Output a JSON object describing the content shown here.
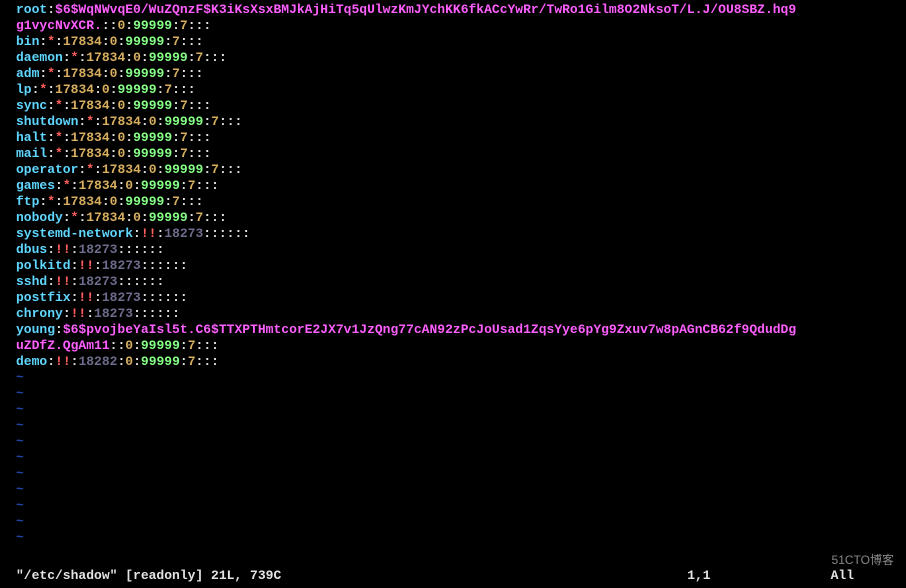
{
  "lines": [
    {
      "segments": [
        {
          "t": "root",
          "c": "c-cyan"
        },
        {
          "t": ":",
          "c": "c-white"
        },
        {
          "t": "$6$WqNWvqE0/WuZQnzF$K3iKsXsxBMJkAjHiTq5qUlwzKmJYchKK6fkACcYwRr/TwRo1Gilm8O2NksoT/L.J/OU8SBZ.hq9",
          "c": "c-pink"
        }
      ]
    },
    {
      "segments": [
        {
          "t": "g1vycNvXCR.",
          "c": "c-pink"
        },
        {
          "t": ":",
          "c": "c-white"
        },
        {
          "t": ":",
          "c": "c-white"
        },
        {
          "t": "0",
          "c": "c-yellow"
        },
        {
          "t": ":",
          "c": "c-white"
        },
        {
          "t": "99999",
          "c": "c-green"
        },
        {
          "t": ":",
          "c": "c-white"
        },
        {
          "t": "7",
          "c": "c-yellow"
        },
        {
          "t": ":::",
          "c": "c-white"
        }
      ]
    },
    {
      "segments": [
        {
          "t": "bin",
          "c": "c-cyan"
        },
        {
          "t": ":",
          "c": "c-white"
        },
        {
          "t": "*",
          "c": "c-red"
        },
        {
          "t": ":",
          "c": "c-white"
        },
        {
          "t": "17834",
          "c": "c-yellow"
        },
        {
          "t": ":",
          "c": "c-white"
        },
        {
          "t": "0",
          "c": "c-yellow"
        },
        {
          "t": ":",
          "c": "c-white"
        },
        {
          "t": "99999",
          "c": "c-green"
        },
        {
          "t": ":",
          "c": "c-white"
        },
        {
          "t": "7",
          "c": "c-yellow"
        },
        {
          "t": ":::",
          "c": "c-white"
        }
      ]
    },
    {
      "segments": [
        {
          "t": "daemon",
          "c": "c-cyan"
        },
        {
          "t": ":",
          "c": "c-white"
        },
        {
          "t": "*",
          "c": "c-red"
        },
        {
          "t": ":",
          "c": "c-white"
        },
        {
          "t": "17834",
          "c": "c-yellow"
        },
        {
          "t": ":",
          "c": "c-white"
        },
        {
          "t": "0",
          "c": "c-yellow"
        },
        {
          "t": ":",
          "c": "c-white"
        },
        {
          "t": "99999",
          "c": "c-green"
        },
        {
          "t": ":",
          "c": "c-white"
        },
        {
          "t": "7",
          "c": "c-yellow"
        },
        {
          "t": ":::",
          "c": "c-white"
        }
      ]
    },
    {
      "segments": [
        {
          "t": "adm",
          "c": "c-cyan"
        },
        {
          "t": ":",
          "c": "c-white"
        },
        {
          "t": "*",
          "c": "c-red"
        },
        {
          "t": ":",
          "c": "c-white"
        },
        {
          "t": "17834",
          "c": "c-yellow"
        },
        {
          "t": ":",
          "c": "c-white"
        },
        {
          "t": "0",
          "c": "c-yellow"
        },
        {
          "t": ":",
          "c": "c-white"
        },
        {
          "t": "99999",
          "c": "c-green"
        },
        {
          "t": ":",
          "c": "c-white"
        },
        {
          "t": "7",
          "c": "c-yellow"
        },
        {
          "t": ":::",
          "c": "c-white"
        }
      ]
    },
    {
      "segments": [
        {
          "t": "lp",
          "c": "c-cyan"
        },
        {
          "t": ":",
          "c": "c-white"
        },
        {
          "t": "*",
          "c": "c-red"
        },
        {
          "t": ":",
          "c": "c-white"
        },
        {
          "t": "17834",
          "c": "c-yellow"
        },
        {
          "t": ":",
          "c": "c-white"
        },
        {
          "t": "0",
          "c": "c-yellow"
        },
        {
          "t": ":",
          "c": "c-white"
        },
        {
          "t": "99999",
          "c": "c-green"
        },
        {
          "t": ":",
          "c": "c-white"
        },
        {
          "t": "7",
          "c": "c-yellow"
        },
        {
          "t": ":::",
          "c": "c-white"
        }
      ]
    },
    {
      "segments": [
        {
          "t": "sync",
          "c": "c-cyan"
        },
        {
          "t": ":",
          "c": "c-white"
        },
        {
          "t": "*",
          "c": "c-red"
        },
        {
          "t": ":",
          "c": "c-white"
        },
        {
          "t": "17834",
          "c": "c-yellow"
        },
        {
          "t": ":",
          "c": "c-white"
        },
        {
          "t": "0",
          "c": "c-yellow"
        },
        {
          "t": ":",
          "c": "c-white"
        },
        {
          "t": "99999",
          "c": "c-green"
        },
        {
          "t": ":",
          "c": "c-white"
        },
        {
          "t": "7",
          "c": "c-yellow"
        },
        {
          "t": ":::",
          "c": "c-white"
        }
      ]
    },
    {
      "segments": [
        {
          "t": "shutdown",
          "c": "c-cyan"
        },
        {
          "t": ":",
          "c": "c-white"
        },
        {
          "t": "*",
          "c": "c-red"
        },
        {
          "t": ":",
          "c": "c-white"
        },
        {
          "t": "17834",
          "c": "c-yellow"
        },
        {
          "t": ":",
          "c": "c-white"
        },
        {
          "t": "0",
          "c": "c-yellow"
        },
        {
          "t": ":",
          "c": "c-white"
        },
        {
          "t": "99999",
          "c": "c-green"
        },
        {
          "t": ":",
          "c": "c-white"
        },
        {
          "t": "7",
          "c": "c-yellow"
        },
        {
          "t": ":::",
          "c": "c-white"
        }
      ]
    },
    {
      "segments": [
        {
          "t": "halt",
          "c": "c-cyan"
        },
        {
          "t": ":",
          "c": "c-white"
        },
        {
          "t": "*",
          "c": "c-red"
        },
        {
          "t": ":",
          "c": "c-white"
        },
        {
          "t": "17834",
          "c": "c-yellow"
        },
        {
          "t": ":",
          "c": "c-white"
        },
        {
          "t": "0",
          "c": "c-yellow"
        },
        {
          "t": ":",
          "c": "c-white"
        },
        {
          "t": "99999",
          "c": "c-green"
        },
        {
          "t": ":",
          "c": "c-white"
        },
        {
          "t": "7",
          "c": "c-yellow"
        },
        {
          "t": ":::",
          "c": "c-white"
        }
      ]
    },
    {
      "segments": [
        {
          "t": "mail",
          "c": "c-cyan"
        },
        {
          "t": ":",
          "c": "c-white"
        },
        {
          "t": "*",
          "c": "c-red"
        },
        {
          "t": ":",
          "c": "c-white"
        },
        {
          "t": "17834",
          "c": "c-yellow"
        },
        {
          "t": ":",
          "c": "c-white"
        },
        {
          "t": "0",
          "c": "c-yellow"
        },
        {
          "t": ":",
          "c": "c-white"
        },
        {
          "t": "99999",
          "c": "c-green"
        },
        {
          "t": ":",
          "c": "c-white"
        },
        {
          "t": "7",
          "c": "c-yellow"
        },
        {
          "t": ":::",
          "c": "c-white"
        }
      ]
    },
    {
      "segments": [
        {
          "t": "operator",
          "c": "c-cyan"
        },
        {
          "t": ":",
          "c": "c-white"
        },
        {
          "t": "*",
          "c": "c-red"
        },
        {
          "t": ":",
          "c": "c-white"
        },
        {
          "t": "17834",
          "c": "c-yellow"
        },
        {
          "t": ":",
          "c": "c-white"
        },
        {
          "t": "0",
          "c": "c-yellow"
        },
        {
          "t": ":",
          "c": "c-white"
        },
        {
          "t": "99999",
          "c": "c-green"
        },
        {
          "t": ":",
          "c": "c-white"
        },
        {
          "t": "7",
          "c": "c-yellow"
        },
        {
          "t": ":::",
          "c": "c-white"
        }
      ]
    },
    {
      "segments": [
        {
          "t": "games",
          "c": "c-cyan"
        },
        {
          "t": ":",
          "c": "c-white"
        },
        {
          "t": "*",
          "c": "c-red"
        },
        {
          "t": ":",
          "c": "c-white"
        },
        {
          "t": "17834",
          "c": "c-yellow"
        },
        {
          "t": ":",
          "c": "c-white"
        },
        {
          "t": "0",
          "c": "c-yellow"
        },
        {
          "t": ":",
          "c": "c-white"
        },
        {
          "t": "99999",
          "c": "c-green"
        },
        {
          "t": ":",
          "c": "c-white"
        },
        {
          "t": "7",
          "c": "c-yellow"
        },
        {
          "t": ":::",
          "c": "c-white"
        }
      ]
    },
    {
      "segments": [
        {
          "t": "ftp",
          "c": "c-cyan"
        },
        {
          "t": ":",
          "c": "c-white"
        },
        {
          "t": "*",
          "c": "c-red"
        },
        {
          "t": ":",
          "c": "c-white"
        },
        {
          "t": "17834",
          "c": "c-yellow"
        },
        {
          "t": ":",
          "c": "c-white"
        },
        {
          "t": "0",
          "c": "c-yellow"
        },
        {
          "t": ":",
          "c": "c-white"
        },
        {
          "t": "99999",
          "c": "c-green"
        },
        {
          "t": ":",
          "c": "c-white"
        },
        {
          "t": "7",
          "c": "c-yellow"
        },
        {
          "t": ":::",
          "c": "c-white"
        }
      ]
    },
    {
      "segments": [
        {
          "t": "nobody",
          "c": "c-cyan"
        },
        {
          "t": ":",
          "c": "c-white"
        },
        {
          "t": "*",
          "c": "c-red"
        },
        {
          "t": ":",
          "c": "c-white"
        },
        {
          "t": "17834",
          "c": "c-yellow"
        },
        {
          "t": ":",
          "c": "c-white"
        },
        {
          "t": "0",
          "c": "c-yellow"
        },
        {
          "t": ":",
          "c": "c-white"
        },
        {
          "t": "99999",
          "c": "c-green"
        },
        {
          "t": ":",
          "c": "c-white"
        },
        {
          "t": "7",
          "c": "c-yellow"
        },
        {
          "t": ":::",
          "c": "c-white"
        }
      ]
    },
    {
      "segments": [
        {
          "t": "systemd-network",
          "c": "c-cyan"
        },
        {
          "t": ":",
          "c": "c-white"
        },
        {
          "t": "!!",
          "c": "c-red"
        },
        {
          "t": ":",
          "c": "c-white"
        },
        {
          "t": "18273",
          "c": "c-grey"
        },
        {
          "t": "::::::",
          "c": "c-white"
        }
      ]
    },
    {
      "segments": [
        {
          "t": "dbus",
          "c": "c-cyan"
        },
        {
          "t": ":",
          "c": "c-white"
        },
        {
          "t": "!!",
          "c": "c-red"
        },
        {
          "t": ":",
          "c": "c-white"
        },
        {
          "t": "18273",
          "c": "c-grey"
        },
        {
          "t": "::::::",
          "c": "c-white"
        }
      ]
    },
    {
      "segments": [
        {
          "t": "polkitd",
          "c": "c-cyan"
        },
        {
          "t": ":",
          "c": "c-white"
        },
        {
          "t": "!!",
          "c": "c-red"
        },
        {
          "t": ":",
          "c": "c-white"
        },
        {
          "t": "18273",
          "c": "c-grey"
        },
        {
          "t": "::::::",
          "c": "c-white"
        }
      ]
    },
    {
      "segments": [
        {
          "t": "sshd",
          "c": "c-cyan"
        },
        {
          "t": ":",
          "c": "c-white"
        },
        {
          "t": "!!",
          "c": "c-red"
        },
        {
          "t": ":",
          "c": "c-white"
        },
        {
          "t": "18273",
          "c": "c-grey"
        },
        {
          "t": "::::::",
          "c": "c-white"
        }
      ]
    },
    {
      "segments": [
        {
          "t": "postfix",
          "c": "c-cyan"
        },
        {
          "t": ":",
          "c": "c-white"
        },
        {
          "t": "!!",
          "c": "c-red"
        },
        {
          "t": ":",
          "c": "c-white"
        },
        {
          "t": "18273",
          "c": "c-grey"
        },
        {
          "t": "::::::",
          "c": "c-white"
        }
      ]
    },
    {
      "segments": [
        {
          "t": "chrony",
          "c": "c-cyan"
        },
        {
          "t": ":",
          "c": "c-white"
        },
        {
          "t": "!!",
          "c": "c-red"
        },
        {
          "t": ":",
          "c": "c-white"
        },
        {
          "t": "18273",
          "c": "c-grey"
        },
        {
          "t": "::::::",
          "c": "c-white"
        }
      ]
    },
    {
      "segments": [
        {
          "t": "young",
          "c": "c-cyan"
        },
        {
          "t": ":",
          "c": "c-white"
        },
        {
          "t": "$6$pvojbeYaIsl5t.C6$TTXPTHmtcorE2JX7v1JzQng77cAN92zPcJoUsad1ZqsYye6pYg9Zxuv7w8pAGnCB62f9QdudDg",
          "c": "c-pink"
        }
      ]
    },
    {
      "segments": [
        {
          "t": "uZDfZ.QgAm11",
          "c": "c-pink"
        },
        {
          "t": ":",
          "c": "c-white"
        },
        {
          "t": ":",
          "c": "c-white"
        },
        {
          "t": "0",
          "c": "c-yellow"
        },
        {
          "t": ":",
          "c": "c-white"
        },
        {
          "t": "99999",
          "c": "c-green"
        },
        {
          "t": ":",
          "c": "c-white"
        },
        {
          "t": "7",
          "c": "c-yellow"
        },
        {
          "t": ":::",
          "c": "c-white"
        }
      ]
    },
    {
      "segments": [
        {
          "t": "demo",
          "c": "c-cyan"
        },
        {
          "t": ":",
          "c": "c-white"
        },
        {
          "t": "!!",
          "c": "c-red"
        },
        {
          "t": ":",
          "c": "c-white"
        },
        {
          "t": "18282",
          "c": "c-grey"
        },
        {
          "t": ":",
          "c": "c-white"
        },
        {
          "t": "0",
          "c": "c-yellow"
        },
        {
          "t": ":",
          "c": "c-white"
        },
        {
          "t": "99999",
          "c": "c-green"
        },
        {
          "t": ":",
          "c": "c-white"
        },
        {
          "t": "7",
          "c": "c-yellow"
        },
        {
          "t": ":::",
          "c": "c-white"
        }
      ]
    }
  ],
  "tilde": "~",
  "tilde_count": 11,
  "status": {
    "left": "\"/etc/shadow\" [readonly] 21L, 739C",
    "mid": "1,1",
    "right": "All"
  },
  "watermark": "51CTO博客"
}
